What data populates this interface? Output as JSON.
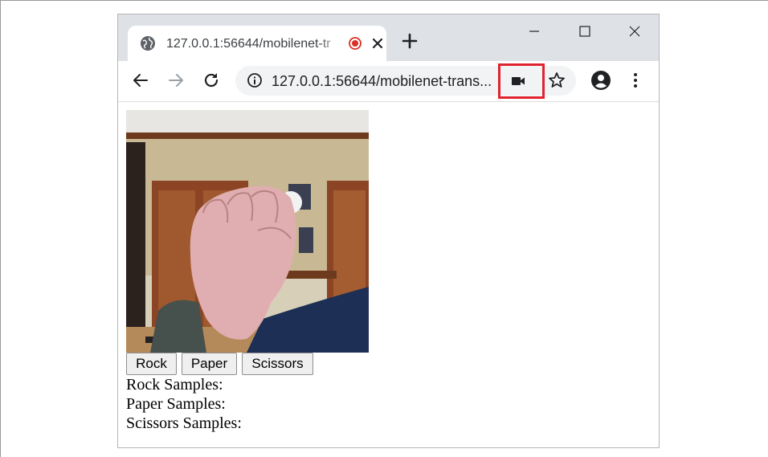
{
  "browser": {
    "tab": {
      "title": "127.0.0.1:56644/mobilenet-tr",
      "icon": "globe-icon",
      "recording_icon": "recording-indicator-icon",
      "close_icon": "close-icon"
    },
    "new_tab_icon": "plus-icon",
    "window_controls": [
      "minimize-icon",
      "maximize-icon",
      "close-icon"
    ],
    "toolbar": {
      "icons": [
        "back-arrow-icon",
        "forward-arrow-icon",
        "reload-icon"
      ],
      "address": {
        "info_icon": "info-icon",
        "url": "127.0.0.1:56644/mobilenet-trans...",
        "camera_icon": "video-camera-icon"
      },
      "bookmark_icon": "star-icon",
      "profile_icon": "account-circle-icon",
      "menu_icon": "vertical-dots-icon"
    },
    "highlight_color": "#e0232f"
  },
  "page": {
    "webcam_alt": "webcam-feed",
    "buttons": {
      "rock": "Rock",
      "paper": "Paper",
      "scissors": "Scissors"
    },
    "samples": {
      "rock": "Rock Samples:",
      "paper": "Paper Samples:",
      "scissors": "Scissors Samples:"
    }
  }
}
